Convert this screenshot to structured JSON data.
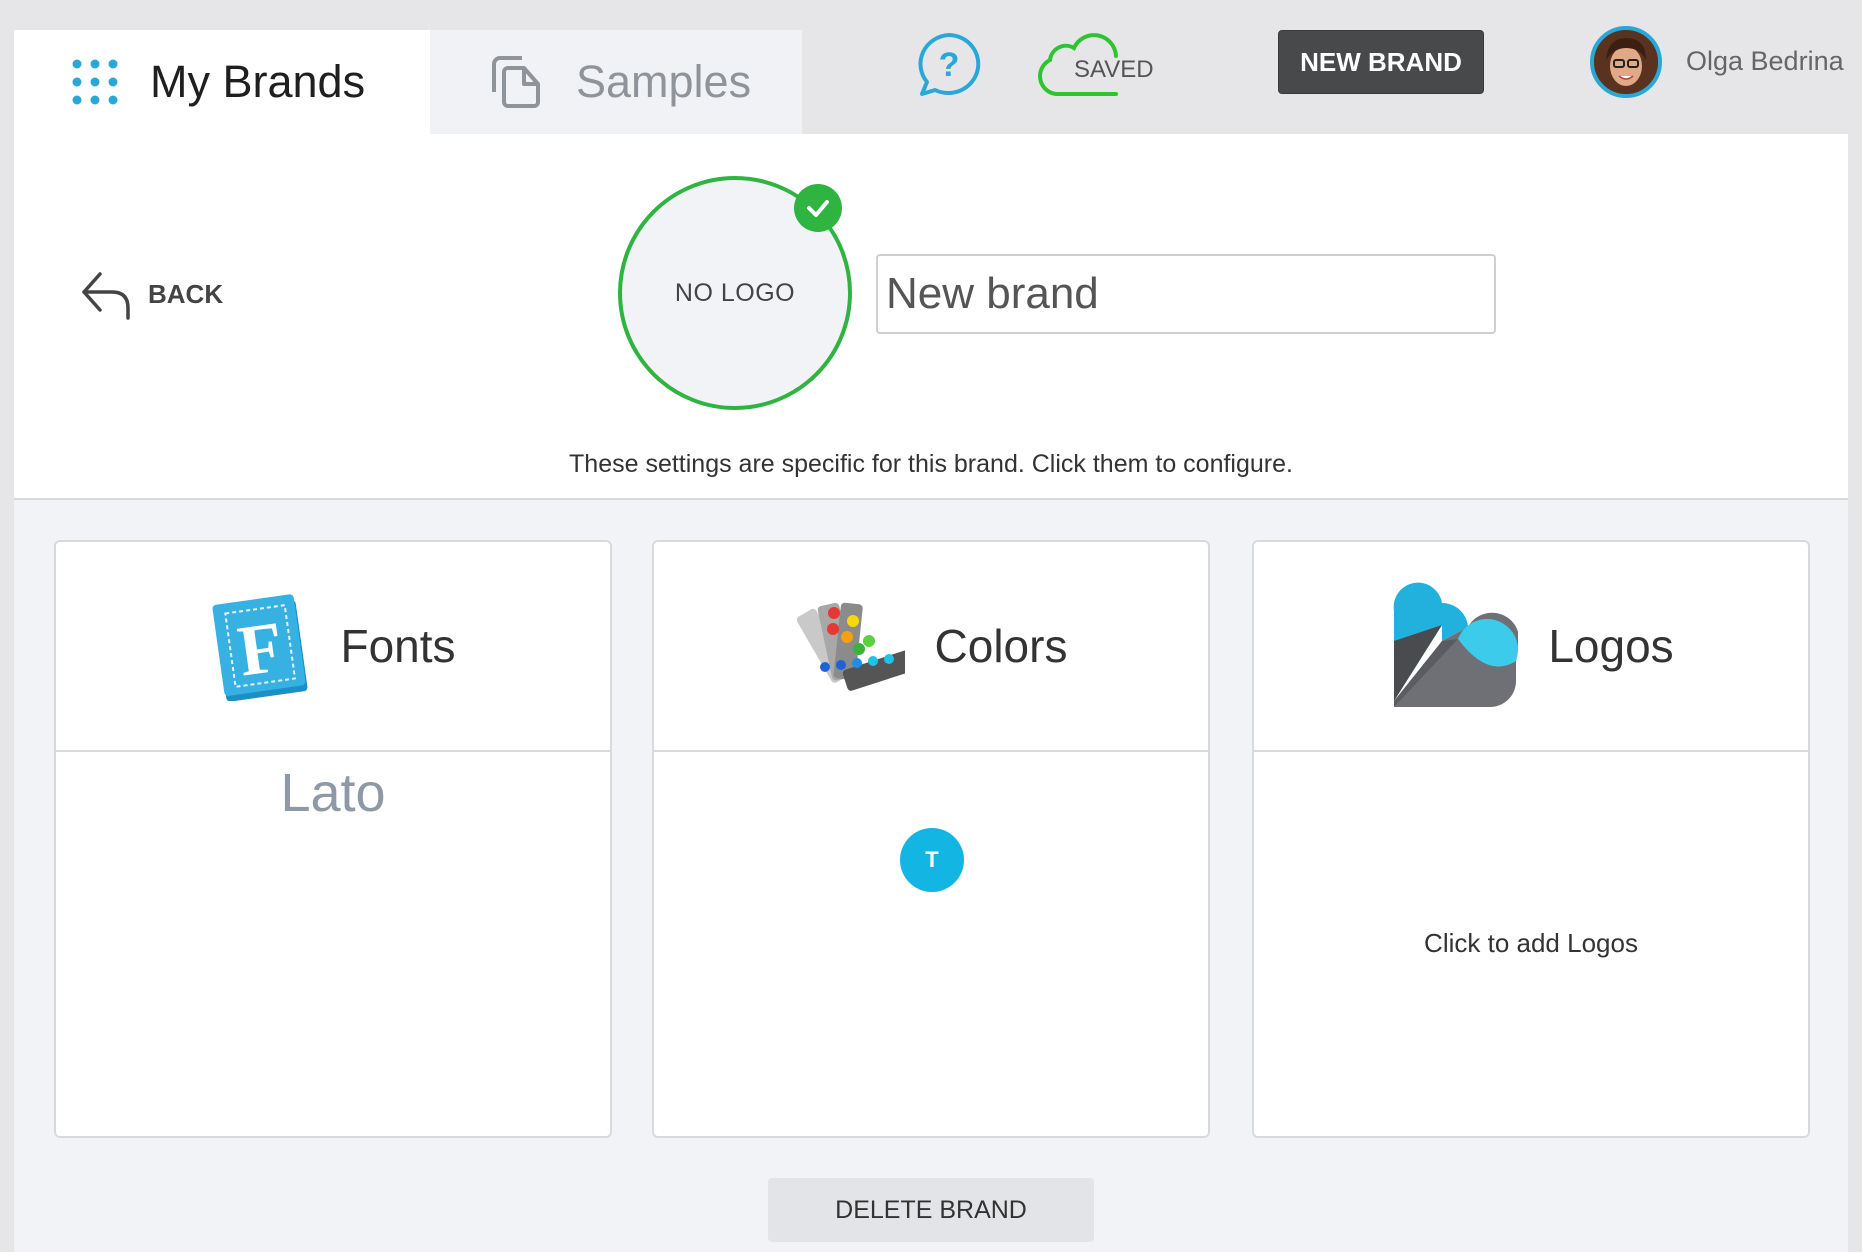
{
  "nav": {
    "tabs": [
      {
        "label": "My Brands",
        "active": true
      },
      {
        "label": "Samples",
        "active": false
      }
    ],
    "saved_label": "SAVED",
    "new_brand_label": "NEW BRAND",
    "user_name": "Olga Bedrina"
  },
  "editor": {
    "back_label": "BACK",
    "logo_placeholder": "NO LOGO",
    "brand_name_value": "New brand",
    "hint": "These settings are specific for this brand. Click them to configure."
  },
  "cards": {
    "fonts": {
      "title": "Fonts",
      "sample": "Lato"
    },
    "colors": {
      "title": "Colors",
      "swatch_letter": "T",
      "swatch_color": "#13b5e3"
    },
    "logos": {
      "title": "Logos",
      "hint": "Click to add Logos"
    }
  },
  "delete_label": "DELETE BRAND",
  "colors": {
    "accent": "#29a8d8",
    "success": "#2fb441",
    "dark_button": "#48494b"
  }
}
